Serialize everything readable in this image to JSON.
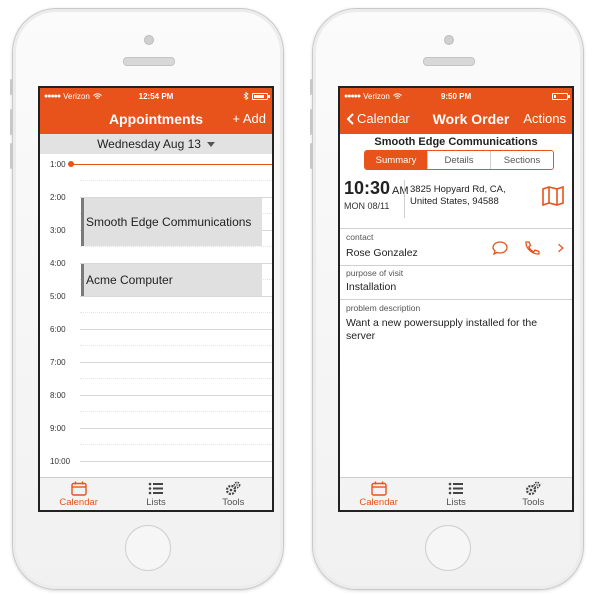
{
  "colors": {
    "accent": "#e8531c",
    "appt_bg": "#e0e0e0",
    "tab_active": "#e8531c"
  },
  "left_phone": {
    "status": {
      "carrier": "Verizon",
      "time": "12:54 PM"
    },
    "nav": {
      "title": "Appointments",
      "add_label": "+ Add"
    },
    "date_label": "Wednesday Aug 13",
    "hours": [
      "1:00",
      "2:00",
      "3:00",
      "4:00",
      "5:00",
      "6:00",
      "7:00",
      "8:00",
      "9:00",
      "10:00"
    ],
    "appointments": [
      {
        "title": "Smooth Edge Communications"
      },
      {
        "title": "Acme Computer"
      }
    ],
    "tabs": [
      {
        "label": "Calendar",
        "icon": "calendar-icon"
      },
      {
        "label": "Lists",
        "icon": "list-icon"
      },
      {
        "label": "Tools",
        "icon": "gear-icon"
      }
    ]
  },
  "right_phone": {
    "status": {
      "carrier": "Verizon",
      "time": "9:50 PM"
    },
    "nav": {
      "back_label": "Calendar",
      "title": "Work Order",
      "actions_label": "Actions"
    },
    "company": "Smooth Edge Communications",
    "segments": [
      "Summary",
      "Details",
      "Sections"
    ],
    "appointment": {
      "time": "10:30",
      "ampm": "AM",
      "date": "MON 08/11",
      "address_line1": "3825 Hopyard Rd, CA,",
      "address_line2": "United States, 94588"
    },
    "contact": {
      "label": "contact",
      "value": "Rose Gonzalez"
    },
    "purpose": {
      "label": "purpose of visit",
      "value": "Installation"
    },
    "problem": {
      "label": "problem description",
      "value": "Want a new powersupply installed for the server"
    },
    "tabs": [
      {
        "label": "Calendar",
        "icon": "calendar-icon"
      },
      {
        "label": "Lists",
        "icon": "list-icon"
      },
      {
        "label": "Tools",
        "icon": "gear-icon"
      }
    ]
  }
}
